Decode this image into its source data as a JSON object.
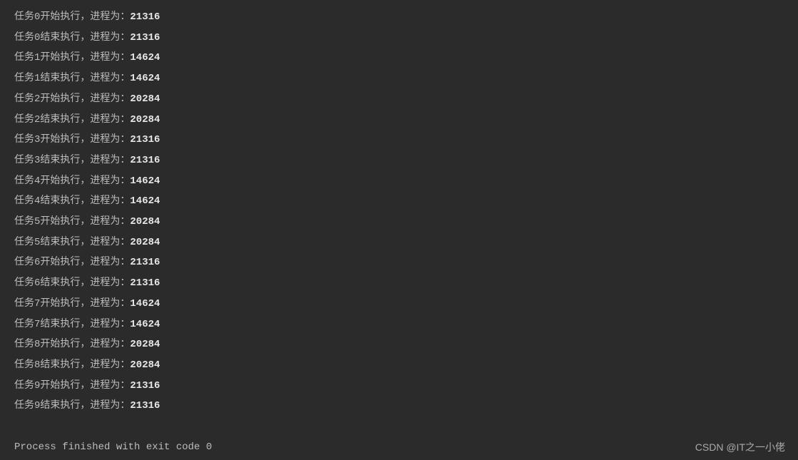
{
  "lines": [
    {
      "label": "任务0开始执行，进程为：",
      "pid": "21316"
    },
    {
      "label": "任务0结束执行，进程为：",
      "pid": "21316"
    },
    {
      "label": "任务1开始执行，进程为：",
      "pid": "14624"
    },
    {
      "label": "任务1结束执行，进程为：",
      "pid": "14624"
    },
    {
      "label": "任务2开始执行，进程为：",
      "pid": "20284"
    },
    {
      "label": "任务2结束执行，进程为：",
      "pid": "20284"
    },
    {
      "label": "任务3开始执行，进程为：",
      "pid": "21316"
    },
    {
      "label": "任务3结束执行，进程为：",
      "pid": "21316"
    },
    {
      "label": "任务4开始执行，进程为：",
      "pid": "14624"
    },
    {
      "label": "任务4结束执行，进程为：",
      "pid": "14624"
    },
    {
      "label": "任务5开始执行，进程为：",
      "pid": "20284"
    },
    {
      "label": "任务5结束执行，进程为：",
      "pid": "20284"
    },
    {
      "label": "任务6开始执行，进程为：",
      "pid": "21316"
    },
    {
      "label": "任务6结束执行，进程为：",
      "pid": "21316"
    },
    {
      "label": "任务7开始执行，进程为：",
      "pid": "14624"
    },
    {
      "label": "任务7结束执行，进程为：",
      "pid": "14624"
    },
    {
      "label": "任务8开始执行，进程为：",
      "pid": "20284"
    },
    {
      "label": "任务8结束执行，进程为：",
      "pid": "20284"
    },
    {
      "label": "任务9开始执行，进程为：",
      "pid": "21316"
    },
    {
      "label": "任务9结束执行，进程为：",
      "pid": "21316"
    }
  ],
  "exit_message": "Process finished with exit code 0",
  "watermark": "CSDN @IT之一小佬"
}
